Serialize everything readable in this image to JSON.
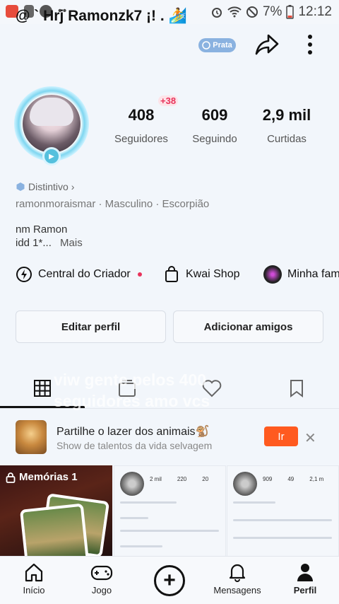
{
  "status_bar": {
    "battery": "7%",
    "time": "12:12",
    "dots": "••"
  },
  "header": {
    "username": "@ ` Hrj Ramonzk7 ¡! . 🏄",
    "badge": "Prata"
  },
  "stats": {
    "new_followers_badge": "+38",
    "followers": {
      "value": "408",
      "label": "Seguidores"
    },
    "following": {
      "value": "609",
      "label": "Seguindo"
    },
    "likes": {
      "value": "2,9 mil",
      "label": "Curtidas"
    }
  },
  "profile": {
    "distinctive": "Distintivo",
    "info": "ramonmoraismar · Masculino · Escorpião",
    "bio_line1": "nm Ramon",
    "bio_line2": "idd 1*...",
    "bio_more": "Mais"
  },
  "shortcuts": {
    "creator_center": "Central do Criador",
    "kwai_shop": "Kwai Shop",
    "minha_fam": "Minha fam"
  },
  "actions": {
    "edit_profile": "Editar perfil",
    "add_friends": "Adicionar amigos"
  },
  "overlay_caption": "viw gente pelos 400 seguidores amo vcs",
  "promo": {
    "title": "Partilhe o lazer dos animais🐒",
    "subtitle": "Show de talentos da vida selvagem",
    "button": "Ir"
  },
  "grid": {
    "memories_label": "Memórias 1",
    "card2_stats": [
      "2 mil",
      "220",
      "20"
    ],
    "card3_stats": [
      "909",
      "49",
      "2,1 m"
    ]
  },
  "bottom_nav": {
    "home": "Início",
    "game": "Jogo",
    "messages": "Mensagens",
    "profile": "Perfil"
  },
  "colors": {
    "accent": "#ff5a1f",
    "alert": "#e8335b",
    "badge": "#8ab2e0"
  }
}
